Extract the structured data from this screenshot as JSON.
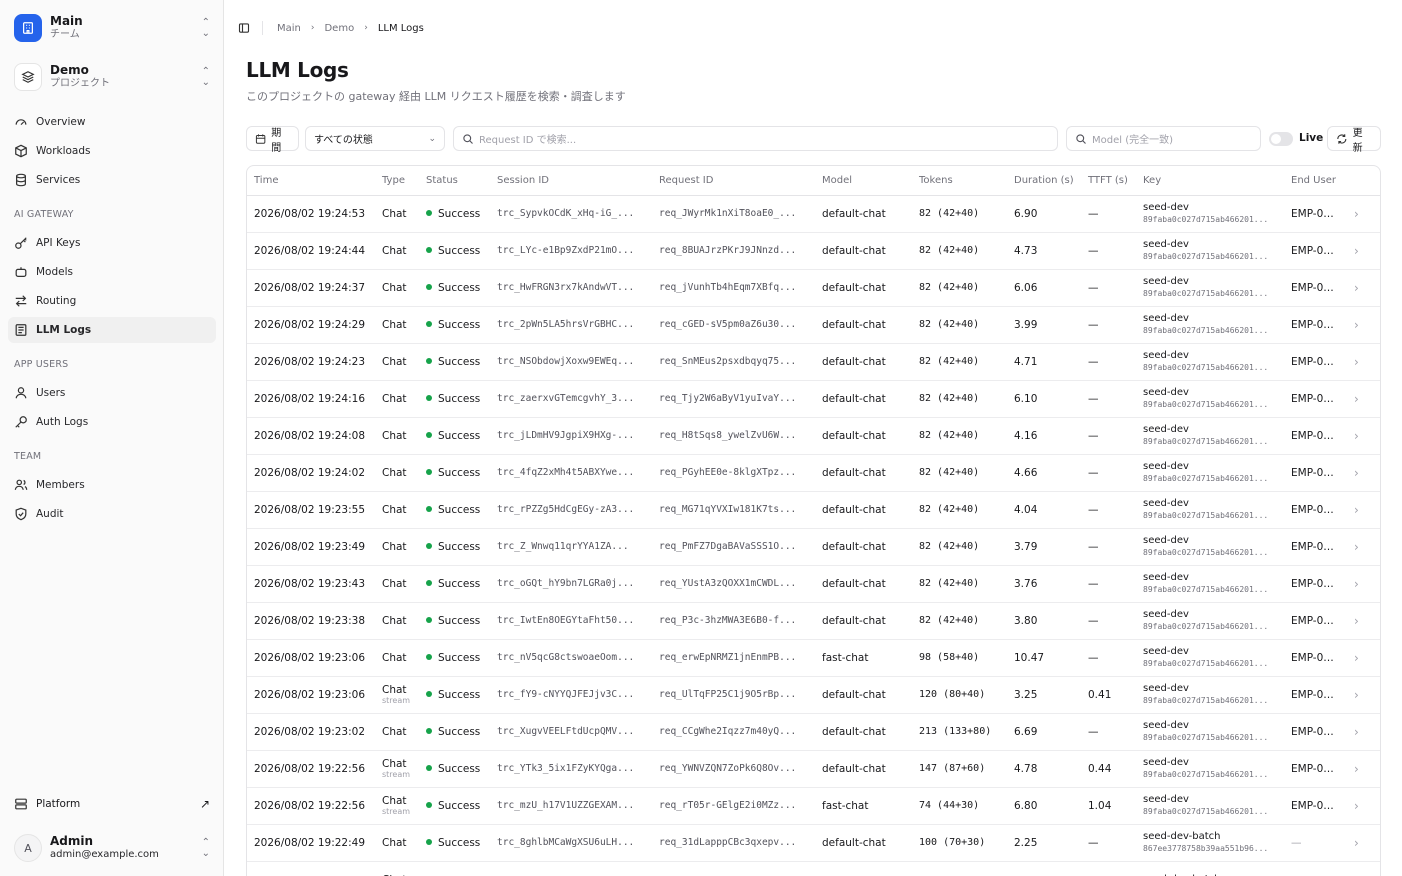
{
  "team": {
    "title": "Main",
    "subtitle": "チーム"
  },
  "project": {
    "title": "Demo",
    "subtitle": "プロジェクト"
  },
  "nav": {
    "overview": "Overview",
    "workloads": "Workloads",
    "services": "Services",
    "ai_gateway_label": "AI GATEWAY",
    "api_keys": "API Keys",
    "models": "Models",
    "routing": "Routing",
    "llm_logs": "LLM Logs",
    "app_users_label": "APP USERS",
    "users": "Users",
    "auth_logs": "Auth Logs",
    "team_label": "TEAM",
    "members": "Members",
    "audit": "Audit"
  },
  "platform": {
    "label": "Platform"
  },
  "user": {
    "initial": "A",
    "name": "Admin",
    "email": "admin@example.com"
  },
  "breadcrumb": [
    "Main",
    "Demo",
    "LLM Logs"
  ],
  "page": {
    "title": "LLM Logs",
    "description": "このプロジェクトの gateway 経由 LLM リクエスト履歴を検索・調査します"
  },
  "filters": {
    "period_label": "期間",
    "status_value": "すべての状態",
    "request_search_placeholder": "Request ID で検索...",
    "model_search_placeholder": "Model (完全一致)",
    "live_label": "Live",
    "refresh_label": "更新"
  },
  "colors": {
    "success": "#16a34a",
    "accent": "#2563eb"
  },
  "table": {
    "headers": [
      "Time",
      "Type",
      "Status",
      "Session ID",
      "Request ID",
      "Model",
      "Tokens",
      "Duration (s)",
      "TTFT (s)",
      "Key",
      "End User"
    ],
    "rows": [
      {
        "time": "2026/08/02 19:24:53",
        "type": "Chat",
        "sub": "",
        "status": "Success",
        "session": "trc_SypvkOCdK_xHq-iG_...",
        "request": "req_JWyrMk1nXiT8oaE0_...",
        "model": "default-chat",
        "tokens": "82 (42+40)",
        "duration": "6.90",
        "ttft": "—",
        "key": "seed-dev",
        "hash": "89faba0c027d715ab466201...",
        "user": "EMP-0001"
      },
      {
        "time": "2026/08/02 19:24:44",
        "type": "Chat",
        "sub": "",
        "status": "Success",
        "session": "trc_LYc-e1Bp9ZxdP21mO...",
        "request": "req_8BUAJrzPKrJ9JNnzd...",
        "model": "default-chat",
        "tokens": "82 (42+40)",
        "duration": "4.73",
        "ttft": "—",
        "key": "seed-dev",
        "hash": "89faba0c027d715ab466201...",
        "user": "EMP-0001"
      },
      {
        "time": "2026/08/02 19:24:37",
        "type": "Chat",
        "sub": "",
        "status": "Success",
        "session": "trc_HwFRGN3rx7kAndwVT...",
        "request": "req_jVunhTb4hEqm7XBfq...",
        "model": "default-chat",
        "tokens": "82 (42+40)",
        "duration": "6.06",
        "ttft": "—",
        "key": "seed-dev",
        "hash": "89faba0c027d715ab466201...",
        "user": "EMP-0001"
      },
      {
        "time": "2026/08/02 19:24:29",
        "type": "Chat",
        "sub": "",
        "status": "Success",
        "session": "trc_2pWn5LA5hrsVrGBHC...",
        "request": "req_cGED-sV5pm0aZ6u30...",
        "model": "default-chat",
        "tokens": "82 (42+40)",
        "duration": "3.99",
        "ttft": "—",
        "key": "seed-dev",
        "hash": "89faba0c027d715ab466201...",
        "user": "EMP-0001"
      },
      {
        "time": "2026/08/02 19:24:23",
        "type": "Chat",
        "sub": "",
        "status": "Success",
        "session": "trc_NSObdowjXoxw9EWEq...",
        "request": "req_SnMEus2psxdbqyq75...",
        "model": "default-chat",
        "tokens": "82 (42+40)",
        "duration": "4.71",
        "ttft": "—",
        "key": "seed-dev",
        "hash": "89faba0c027d715ab466201...",
        "user": "EMP-0001"
      },
      {
        "time": "2026/08/02 19:24:16",
        "type": "Chat",
        "sub": "",
        "status": "Success",
        "session": "trc_zaerxvGTemcgvhY_3...",
        "request": "req_Tjy2W6aByV1yuIvaY...",
        "model": "default-chat",
        "tokens": "82 (42+40)",
        "duration": "6.10",
        "ttft": "—",
        "key": "seed-dev",
        "hash": "89faba0c027d715ab466201...",
        "user": "EMP-0001"
      },
      {
        "time": "2026/08/02 19:24:08",
        "type": "Chat",
        "sub": "",
        "status": "Success",
        "session": "trc_jLDmHV9JgpiX9HXg-...",
        "request": "req_H8tSqs8_ywelZvU6W...",
        "model": "default-chat",
        "tokens": "82 (42+40)",
        "duration": "4.16",
        "ttft": "—",
        "key": "seed-dev",
        "hash": "89faba0c027d715ab466201...",
        "user": "EMP-0001"
      },
      {
        "time": "2026/08/02 19:24:02",
        "type": "Chat",
        "sub": "",
        "status": "Success",
        "session": "trc_4fqZ2xMh4t5ABXYwe...",
        "request": "req_PGyhEE0e-8klgXTpz...",
        "model": "default-chat",
        "tokens": "82 (42+40)",
        "duration": "4.66",
        "ttft": "—",
        "key": "seed-dev",
        "hash": "89faba0c027d715ab466201...",
        "user": "EMP-0001"
      },
      {
        "time": "2026/08/02 19:23:55",
        "type": "Chat",
        "sub": "",
        "status": "Success",
        "session": "trc_rPZZg5HdCgEGy-zA3...",
        "request": "req_MG71qYVXIw181K7ts...",
        "model": "default-chat",
        "tokens": "82 (42+40)",
        "duration": "4.04",
        "ttft": "—",
        "key": "seed-dev",
        "hash": "89faba0c027d715ab466201...",
        "user": "EMP-0001"
      },
      {
        "time": "2026/08/02 19:23:49",
        "type": "Chat",
        "sub": "",
        "status": "Success",
        "session": "trc_Z_Wnwq11qrYYA1ZA...",
        "request": "req_PmFZ7DgaBAVaSSS1O...",
        "model": "default-chat",
        "tokens": "82 (42+40)",
        "duration": "3.79",
        "ttft": "—",
        "key": "seed-dev",
        "hash": "89faba0c027d715ab466201...",
        "user": "EMP-0001"
      },
      {
        "time": "2026/08/02 19:23:43",
        "type": "Chat",
        "sub": "",
        "status": "Success",
        "session": "trc_oGQt_hY9bn7LGRa0j...",
        "request": "req_YUstA3zQOXX1mCWDL...",
        "model": "default-chat",
        "tokens": "82 (42+40)",
        "duration": "3.76",
        "ttft": "—",
        "key": "seed-dev",
        "hash": "89faba0c027d715ab466201...",
        "user": "EMP-0001"
      },
      {
        "time": "2026/08/02 19:23:38",
        "type": "Chat",
        "sub": "",
        "status": "Success",
        "session": "trc_IwtEn8OEGYtaFht50...",
        "request": "req_P3c-3hzMWA3E6B0-f...",
        "model": "default-chat",
        "tokens": "82 (42+40)",
        "duration": "3.80",
        "ttft": "—",
        "key": "seed-dev",
        "hash": "89faba0c027d715ab466201...",
        "user": "EMP-0001"
      },
      {
        "time": "2026/08/02 19:23:06",
        "type": "Chat",
        "sub": "",
        "status": "Success",
        "session": "trc_nV5qcG8ctswoaeOom...",
        "request": "req_erwEpNRMZ1jnEnmPB...",
        "model": "fast-chat",
        "tokens": "98 (58+40)",
        "duration": "10.47",
        "ttft": "—",
        "key": "seed-dev",
        "hash": "89faba0c027d715ab466201...",
        "user": "EMP-0001"
      },
      {
        "time": "2026/08/02 19:23:06",
        "type": "Chat",
        "sub": "stream",
        "status": "Success",
        "session": "trc_fY9-cNYYQJFEJjv3C...",
        "request": "req_UlTqFP25C1j9O5rBp...",
        "model": "default-chat",
        "tokens": "120 (80+40)",
        "duration": "3.25",
        "ttft": "0.41",
        "key": "seed-dev",
        "hash": "89faba0c027d715ab466201...",
        "user": "EMP-0001"
      },
      {
        "time": "2026/08/02 19:23:02",
        "type": "Chat",
        "sub": "",
        "status": "Success",
        "session": "trc_XugvVEELFtdUcpQMV...",
        "request": "req_CCgWhe2Iqzz7m40yQ...",
        "model": "default-chat",
        "tokens": "213 (133+80)",
        "duration": "6.69",
        "ttft": "—",
        "key": "seed-dev",
        "hash": "89faba0c027d715ab466201...",
        "user": "EMP-0001"
      },
      {
        "time": "2026/08/02 19:22:56",
        "type": "Chat",
        "sub": "stream",
        "status": "Success",
        "session": "trc_YTk3_5ix1FZyKYQga...",
        "request": "req_YWNVZQN7ZoPk6Q8Ov...",
        "model": "default-chat",
        "tokens": "147 (87+60)",
        "duration": "4.78",
        "ttft": "0.44",
        "key": "seed-dev",
        "hash": "89faba0c027d715ab466201...",
        "user": "EMP-0001"
      },
      {
        "time": "2026/08/02 19:22:56",
        "type": "Chat",
        "sub": "stream",
        "status": "Success",
        "session": "trc_mzU_h17V1UZZGEXAM...",
        "request": "req_rT05r-GElgE2i0MZz...",
        "model": "fast-chat",
        "tokens": "74 (44+30)",
        "duration": "6.80",
        "ttft": "1.04",
        "key": "seed-dev",
        "hash": "89faba0c027d715ab466201...",
        "user": "EMP-0001"
      },
      {
        "time": "2026/08/02 19:22:49",
        "type": "Chat",
        "sub": "",
        "status": "Success",
        "session": "trc_8ghlbMCaWgXSU6uLH...",
        "request": "req_31dLapppCBc3qxepv...",
        "model": "default-chat",
        "tokens": "100 (70+30)",
        "duration": "2.25",
        "ttft": "—",
        "key": "seed-dev-batch",
        "hash": "867ee3778758b39aa551b96...",
        "user": "—"
      },
      {
        "time": "",
        "type": "Chat",
        "sub": "",
        "status": "",
        "session": "",
        "request": "",
        "model": "",
        "tokens": "",
        "duration": "",
        "ttft": "",
        "key": "seed-dev-batch",
        "hash": "",
        "user": ""
      }
    ]
  }
}
